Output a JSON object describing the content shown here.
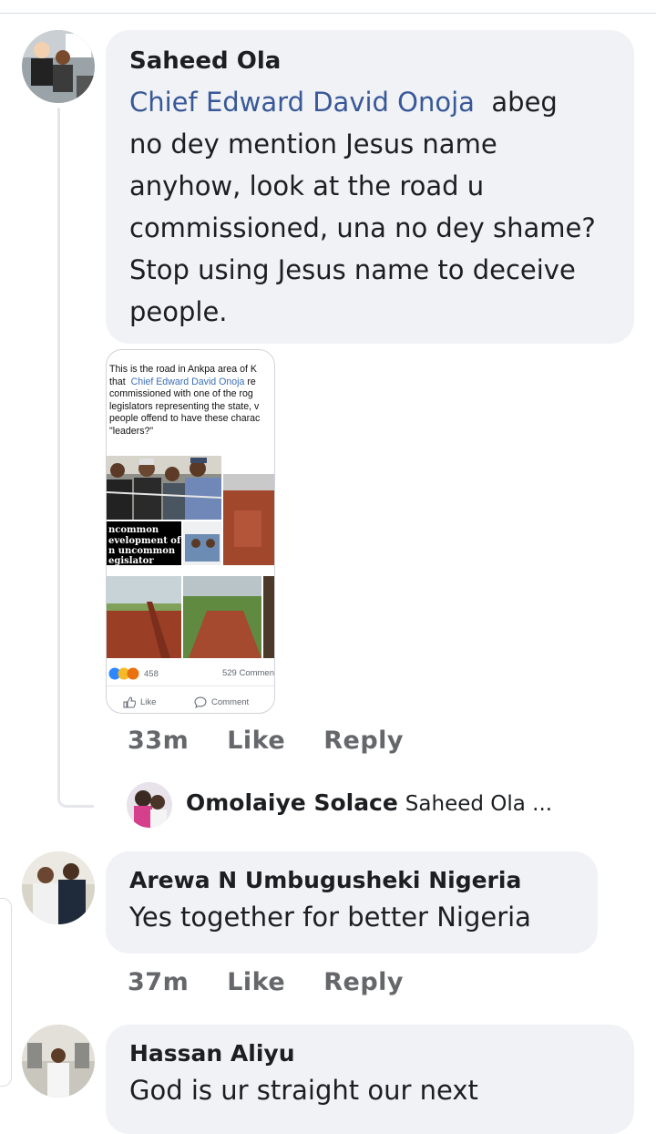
{
  "comments": [
    {
      "author": "Saheed Ola",
      "mention": "Chief Edward David Onoja",
      "text_line1": "abeg",
      "lines": [
        "no dey mention Jesus name",
        "anyhow,  look at the road u",
        "commissioned, una no dey shame?",
        "Stop using Jesus name to deceive",
        "people."
      ],
      "time": "33m",
      "like_label": "Like",
      "reply_label": "Reply"
    },
    {
      "author": "Omolaiye Solace",
      "preview": "Saheed Ola ..."
    },
    {
      "author": "Arewa N Umbugusheki Nigeria",
      "text": "Yes together for better Nigeria",
      "time": "37m",
      "like_label": "Like",
      "reply_label": "Reply"
    },
    {
      "author": "Hassan Aliyu",
      "text": "God is ur straight our next"
    }
  ],
  "attachment": {
    "caption_lines": [
      "This is the road in Ankpa area of K",
      "that",
      "Chief Edward David Onoja",
      "re",
      "commissioned with one of the rog",
      "legislators representing the state, v",
      "people offend to have these charac",
      "\"leaders?\""
    ],
    "banner_lines": [
      "ncommon",
      "evelopment of",
      "n uncommon",
      "egislator"
    ],
    "reaction_count": "458",
    "comment_count": "529 Commen",
    "like_label": "Like",
    "comment_label": "Comment"
  },
  "colors": {
    "bubble": "#f0f2f5",
    "mention": "#385898",
    "meta": "#65676b"
  }
}
